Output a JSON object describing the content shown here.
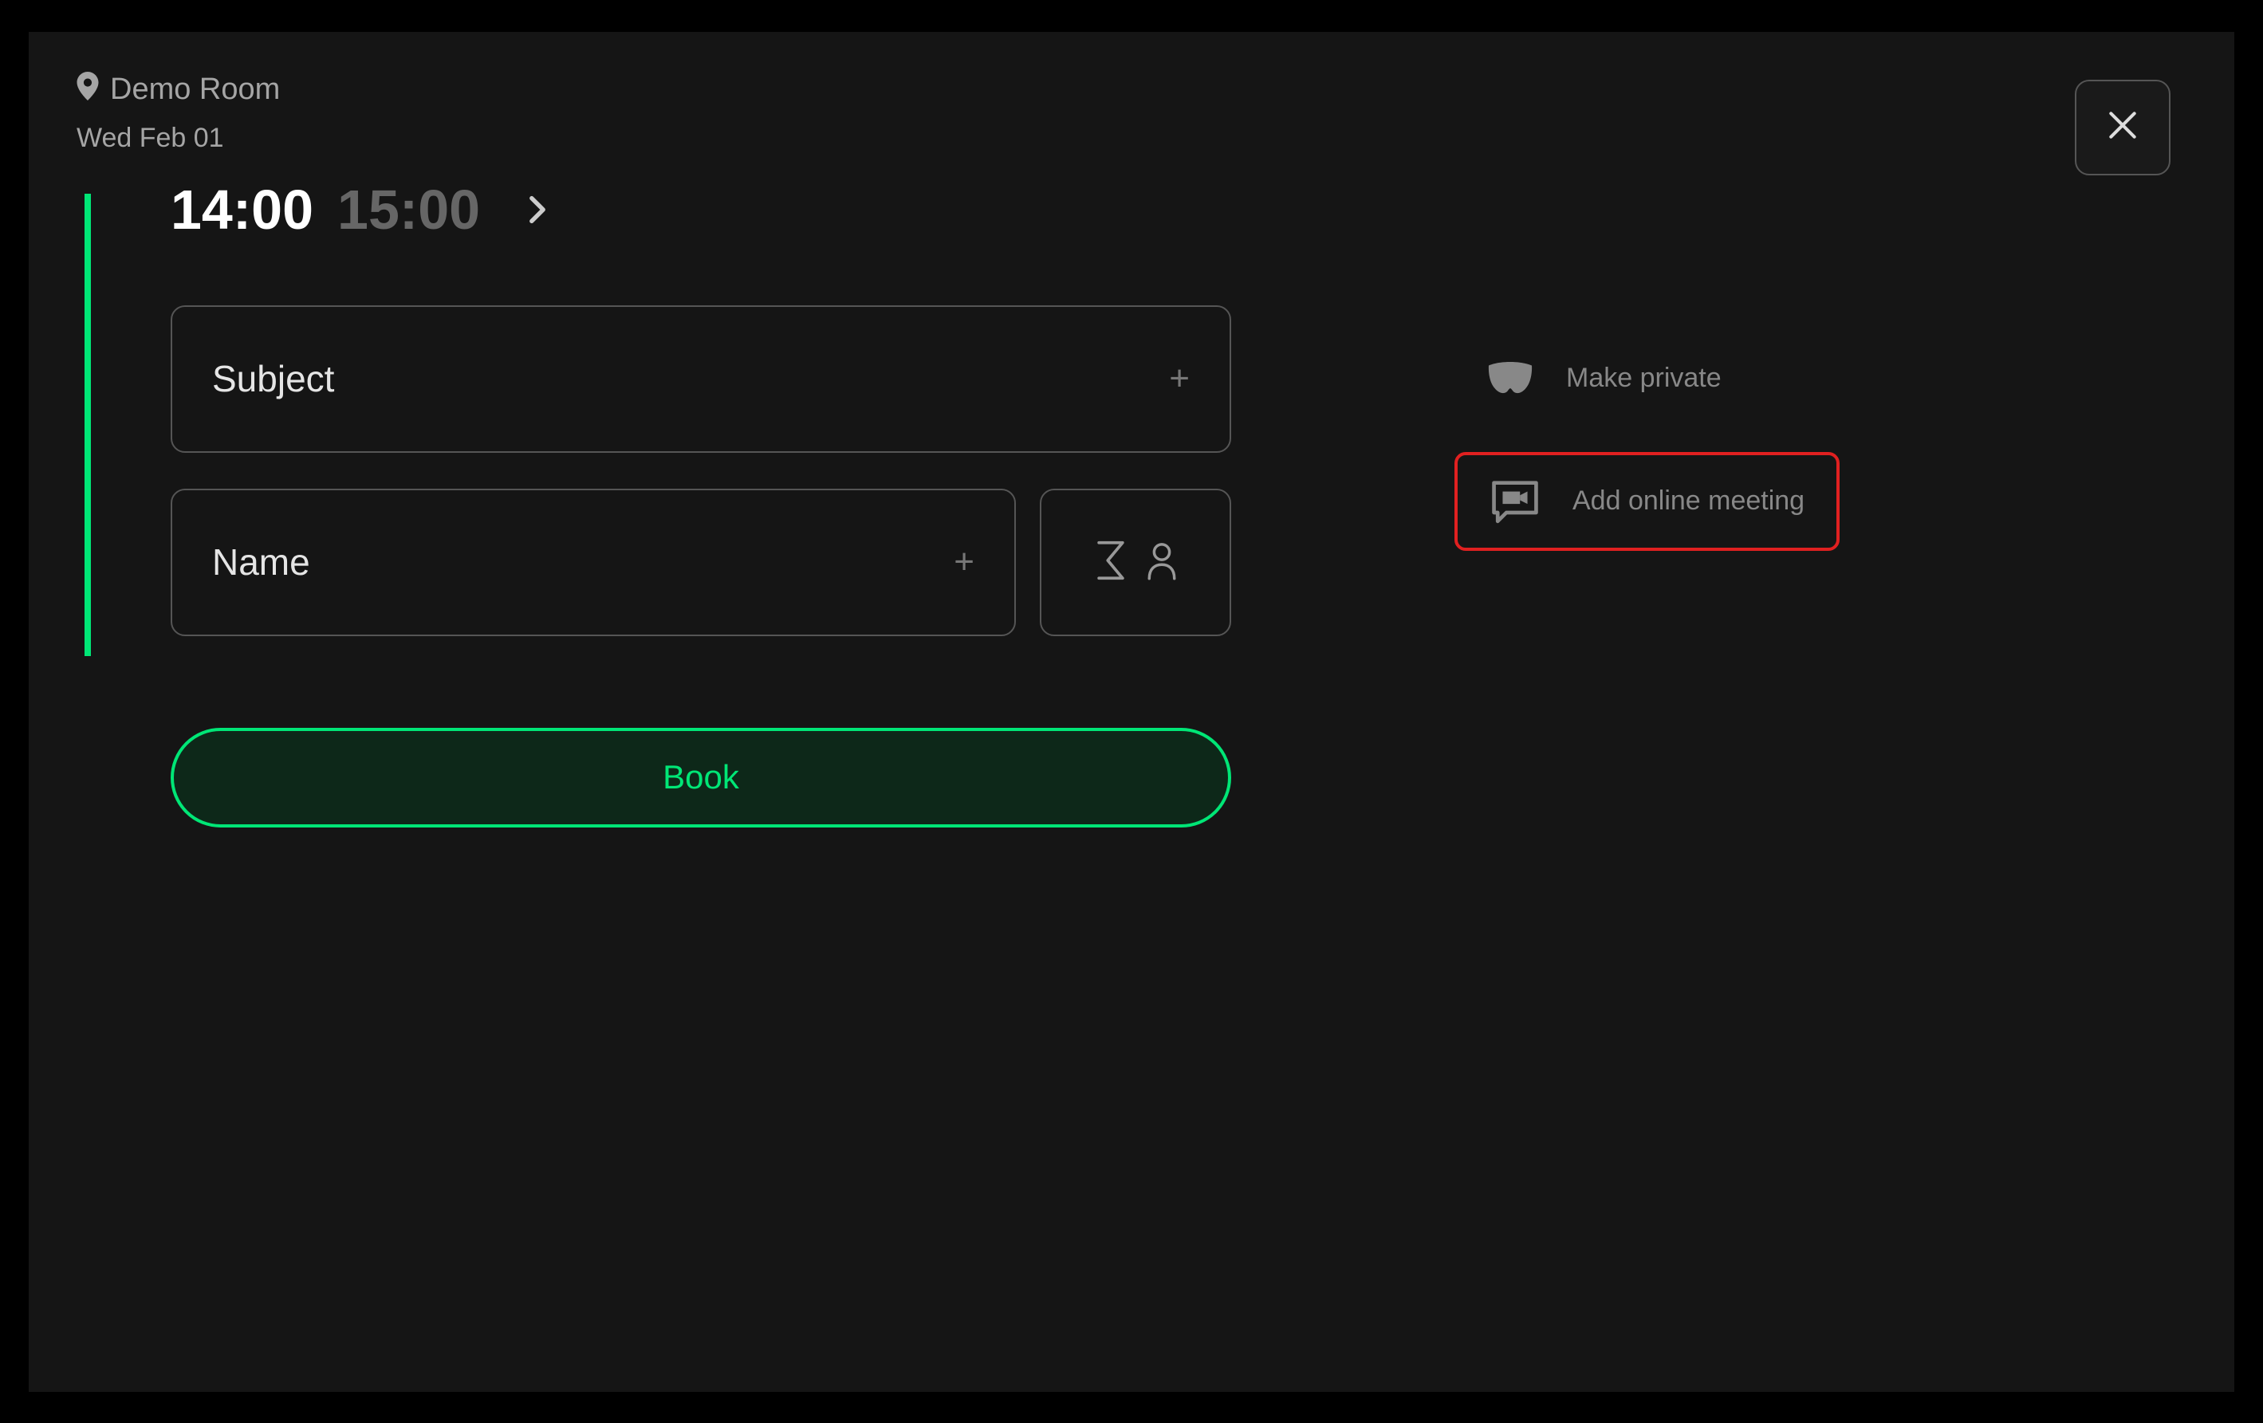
{
  "room": {
    "name": "Demo Room",
    "date": "Wed Feb 01"
  },
  "time": {
    "start": "14:00",
    "end": "15:00"
  },
  "form": {
    "subject_placeholder": "Subject",
    "name_placeholder": "Name"
  },
  "actions": {
    "book_label": "Book"
  },
  "options": {
    "make_private_label": "Make private",
    "add_online_meeting_label": "Add online meeting"
  },
  "colors": {
    "accent": "#00e676",
    "highlight": "#e02020"
  }
}
